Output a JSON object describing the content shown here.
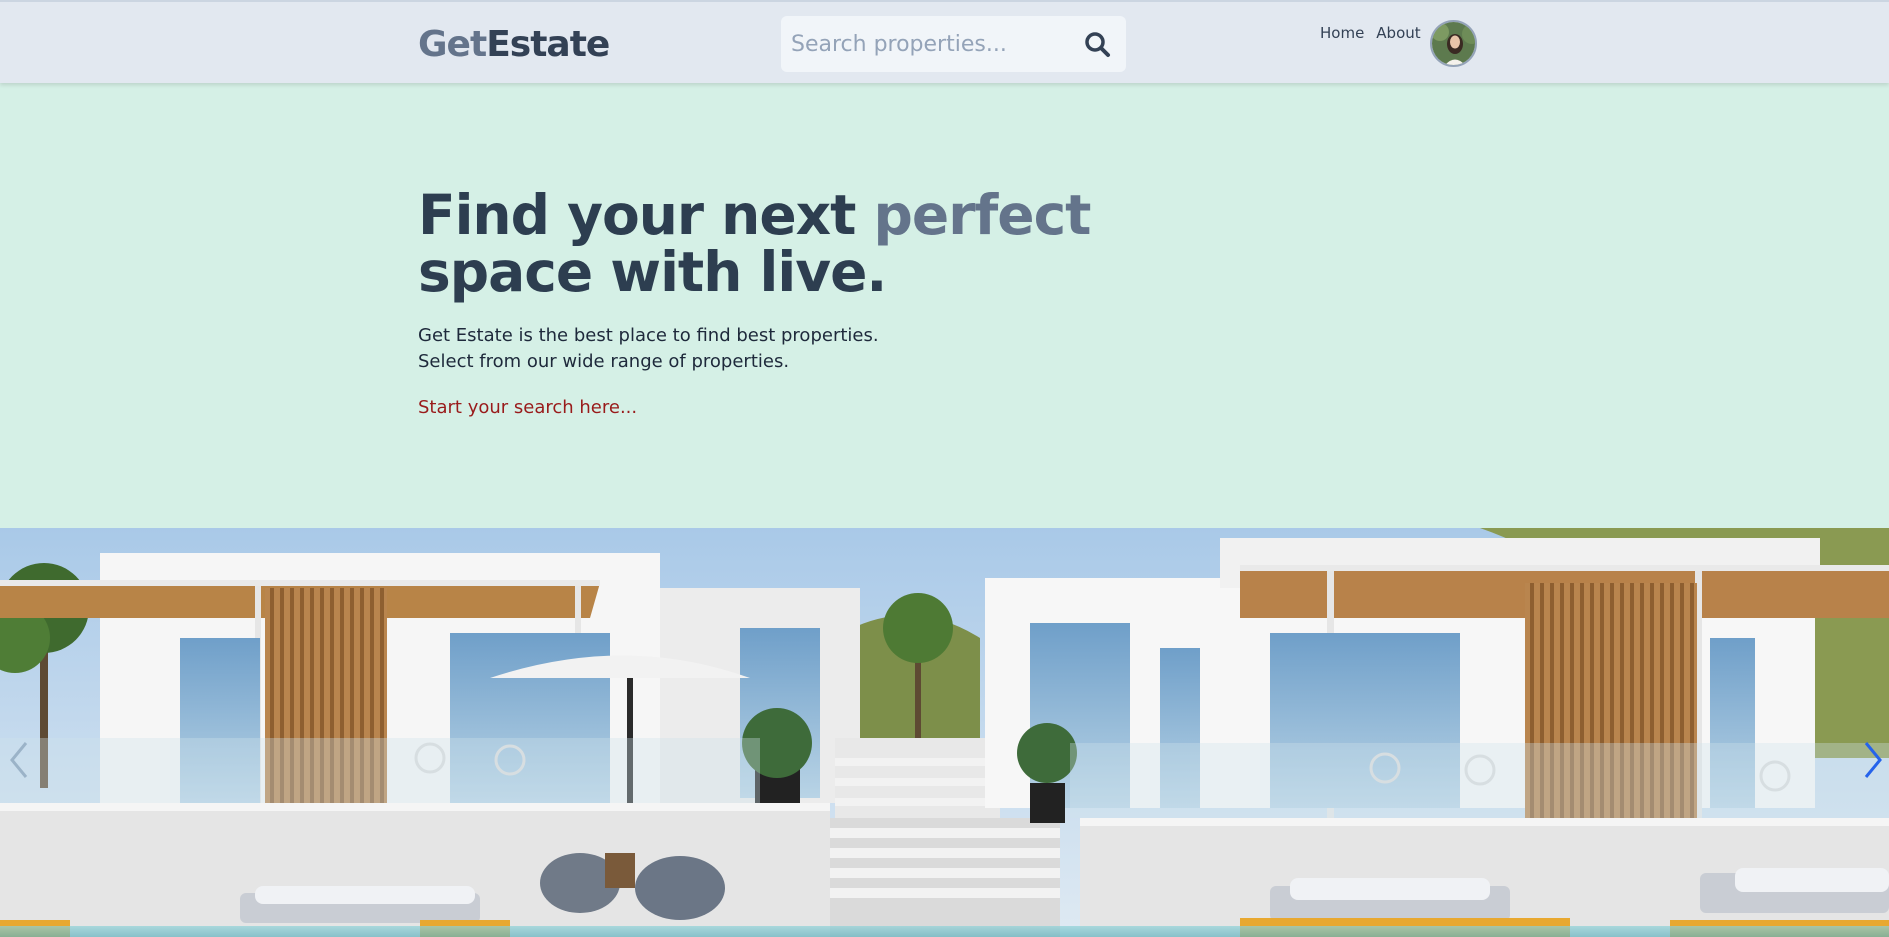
{
  "brand": {
    "prefix": "Get",
    "suffix": "Estate"
  },
  "search": {
    "placeholder": "Search properties...",
    "value": "",
    "icon": "search-icon"
  },
  "nav": {
    "home": "Home",
    "about": "About",
    "avatar": "user-avatar"
  },
  "hero": {
    "headline_line1_part1": "Find your next ",
    "headline_line1_accent": "perfect",
    "headline_line2": "space with live.",
    "subtext_line1": "Get Estate is the best place to find best properties.",
    "subtext_line2": "Select from our wide range of properties.",
    "cta": "Start your search here..."
  },
  "carousel": {
    "prev_icon": "chevron-left-icon",
    "next_icon": "chevron-right-icon"
  },
  "colors": {
    "nav_bg": "#e2e8f0",
    "hero_bg": "#d5f0e6",
    "heading": "#2d3e50",
    "accent": "#64748b",
    "cta": "#991b1b",
    "carousel_arrow": "#2563eb"
  }
}
